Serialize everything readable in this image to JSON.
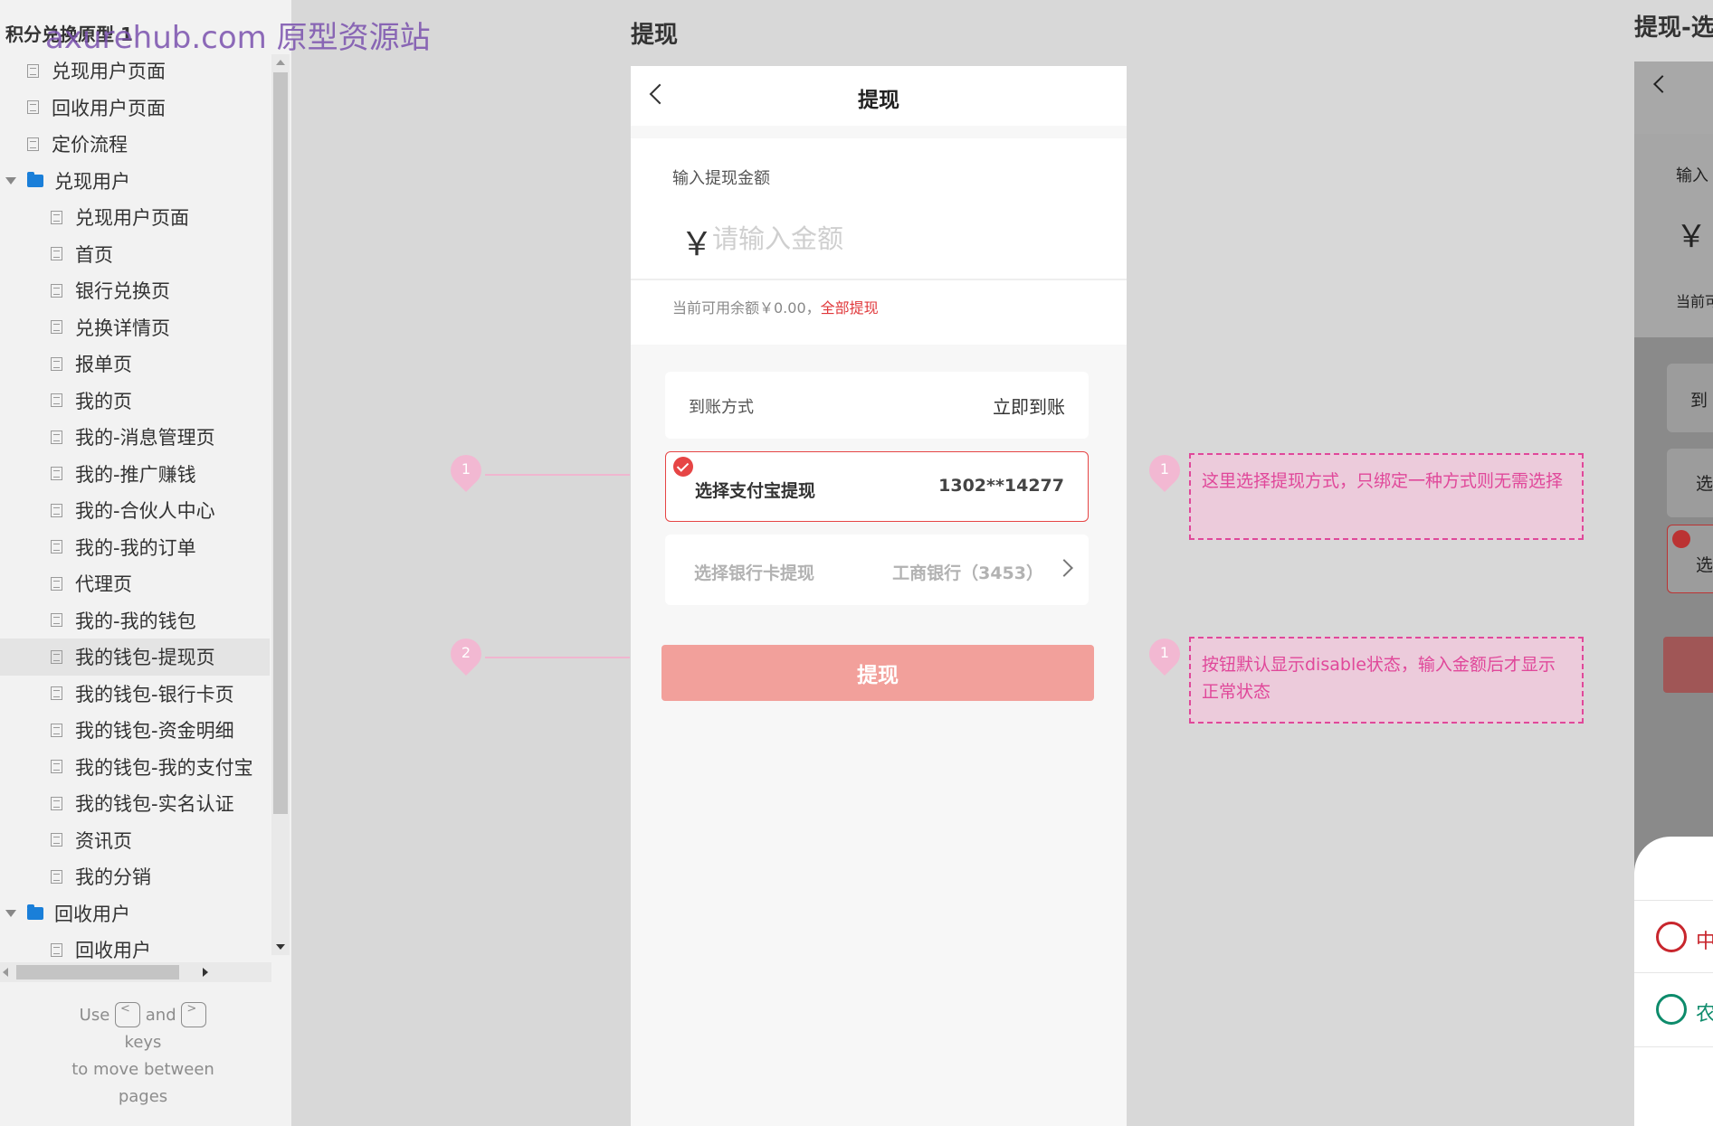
{
  "sidebar": {
    "project_title": "积分兑换原型 1",
    "watermark": "axurehub.com 原型资源站",
    "items": [
      {
        "label": "兑现用户页面",
        "type": "page",
        "level": 0
      },
      {
        "label": "回收用户页面",
        "type": "page",
        "level": 0
      },
      {
        "label": "定价流程",
        "type": "page",
        "level": 0
      },
      {
        "label": "兑现用户",
        "type": "folder",
        "level": 0
      },
      {
        "label": "兑现用户页面",
        "type": "page",
        "level": 1
      },
      {
        "label": "首页",
        "type": "page",
        "level": 1
      },
      {
        "label": "银行兑换页",
        "type": "page",
        "level": 1
      },
      {
        "label": "兑换详情页",
        "type": "page",
        "level": 1
      },
      {
        "label": "报单页",
        "type": "page",
        "level": 1
      },
      {
        "label": "我的页",
        "type": "page",
        "level": 1
      },
      {
        "label": "我的-消息管理页",
        "type": "page",
        "level": 1
      },
      {
        "label": "我的-推广赚钱",
        "type": "page",
        "level": 1
      },
      {
        "label": "我的-合伙人中心",
        "type": "page",
        "level": 1
      },
      {
        "label": "我的-我的订单",
        "type": "page",
        "level": 1
      },
      {
        "label": "代理页",
        "type": "page",
        "level": 1
      },
      {
        "label": "我的-我的钱包",
        "type": "page",
        "level": 1
      },
      {
        "label": "我的钱包-提现页",
        "type": "page",
        "level": 1,
        "selected": true
      },
      {
        "label": "我的钱包-银行卡页",
        "type": "page",
        "level": 1
      },
      {
        "label": "我的钱包-资金明细",
        "type": "page",
        "level": 1
      },
      {
        "label": "我的钱包-我的支付宝",
        "type": "page",
        "level": 1
      },
      {
        "label": "我的钱包-实名认证",
        "type": "page",
        "level": 1
      },
      {
        "label": "资讯页",
        "type": "page",
        "level": 1
      },
      {
        "label": "我的分销",
        "type": "page",
        "level": 1
      },
      {
        "label": "回收用户",
        "type": "folder",
        "level": 0
      },
      {
        "label": "回收用户",
        "type": "page",
        "level": 1
      }
    ],
    "hint": {
      "use": "Use",
      "key_prev": "<",
      "and": "and",
      "key_next": ">",
      "keys": "keys",
      "line2": "to move between",
      "line3": "pages"
    }
  },
  "canvas": {
    "heading": "提现",
    "next_heading": "提现-选"
  },
  "phone": {
    "nav_title": "提现",
    "amount_label": "输入提现金额",
    "currency_symbol": "￥",
    "amount_placeholder": "请输入金额",
    "amount_value": "",
    "balance_text": "当前可用余额￥0.00，",
    "withdraw_all": "全部提现",
    "arrival_label": "到账方式",
    "arrival_value": "立即到账",
    "alipay_label": "选择支付宝提现",
    "alipay_account": "1302**14277",
    "bank_label": "选择银行卡提现",
    "bank_value": "工商银行（3453）",
    "submit_label": "提现"
  },
  "annotations": {
    "left_pins": [
      "1",
      "2"
    ],
    "notes": [
      {
        "pin": "1",
        "text": "这里选择提现方式，只绑定一种方式则无需选择"
      },
      {
        "pin": "1",
        "text": "按钮默认显示disable状态，输入金额后才显示正常状态"
      }
    ]
  },
  "preview": {
    "amount_label": "输入",
    "currency_symbol": "￥",
    "balance": "当前可",
    "arrival": "到",
    "option_a": "选",
    "option_b": "选",
    "bank_a": "中",
    "bank_b": "农"
  },
  "colors": {
    "accent_red": "#e64545",
    "button_disabled": "#f2a09b",
    "note_pink": "#e0489a",
    "folder_blue": "#1a7fd9"
  }
}
